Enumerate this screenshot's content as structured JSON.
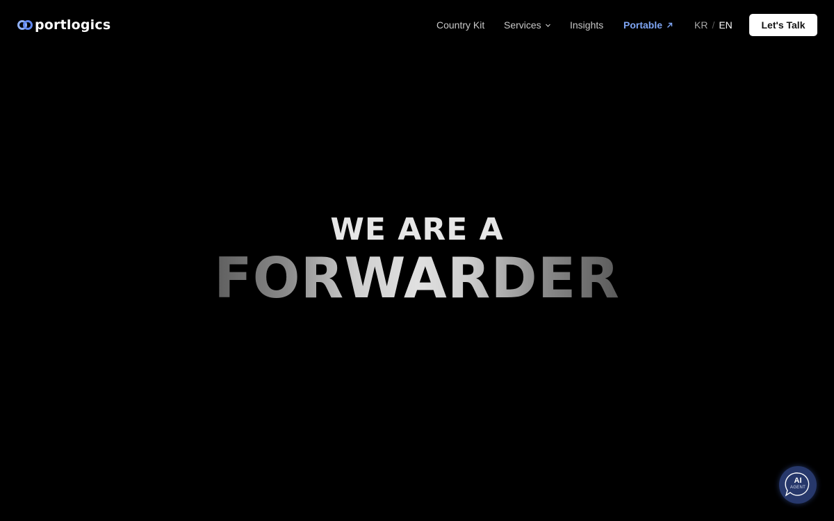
{
  "header": {
    "logo_text": "portlogics",
    "nav": {
      "country_kit": "Country Kit",
      "services": "Services",
      "insights": "Insights",
      "portable": "Portable"
    },
    "lang": {
      "kr": "KR",
      "separator": "/",
      "en": "EN"
    },
    "cta_label": "Let's Talk"
  },
  "hero": {
    "line1": "WE ARE A",
    "line2": "FORWARDER"
  },
  "ai_agent": {
    "label": "AI",
    "sub": "AGENT"
  },
  "icons": {
    "logo": "portlogics-logo-icon",
    "services_chevron": "chevron-down-icon",
    "portable_arrow": "arrow-up-right-icon",
    "ai_agent": "chat-bubble-icon"
  },
  "colors": {
    "background": "#000000",
    "nav_text": "#c9c9c9",
    "portable_accent": "#7fa6f5",
    "cta_bg": "#ffffff",
    "ai_button": "#27386b"
  }
}
